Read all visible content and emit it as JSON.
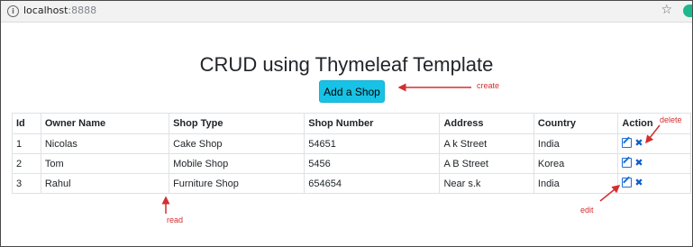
{
  "browser": {
    "url_host": "localhost",
    "url_port": ":8888",
    "info_icon": "info-icon",
    "star_icon": "star-icon"
  },
  "page": {
    "title": "CRUD using Thymeleaf Template",
    "add_button_label": "Add a Shop"
  },
  "table": {
    "headers": [
      "Id",
      "Owner Name",
      "Shop Type",
      "Shop Number",
      "Address",
      "Country",
      "Action"
    ],
    "rows": [
      {
        "id": "1",
        "owner": "Nicolas",
        "type": "Cake Shop",
        "number": "54651",
        "address": "A k Street",
        "country": "India"
      },
      {
        "id": "2",
        "owner": "Tom",
        "type": "Mobile Shop",
        "number": "5456",
        "address": "A B Street",
        "country": "Korea"
      },
      {
        "id": "3",
        "owner": "Rahul",
        "type": "Furniture Shop",
        "number": "654654",
        "address": "Near s.k",
        "country": "India"
      }
    ],
    "action_icons": [
      "edit-icon",
      "delete-icon"
    ]
  },
  "annotations": {
    "create": "create",
    "delete": "delete",
    "read": "read",
    "edit": "edit",
    "color": "#d32f2f"
  },
  "colors": {
    "button_bg": "#17c2e6",
    "icon_blue": "#1b6fd4"
  }
}
